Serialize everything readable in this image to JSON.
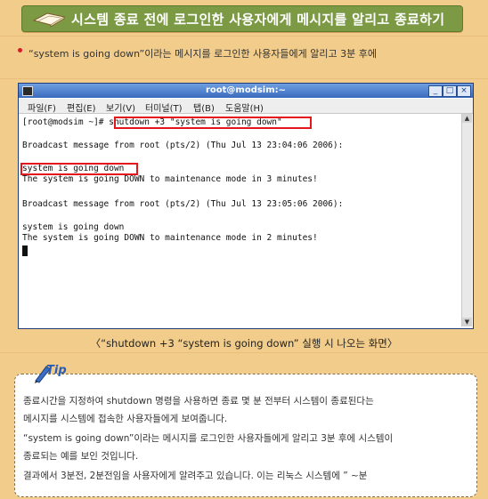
{
  "header": {
    "title": "시스템 종료 전에 로그인한 사용자에게 메시지를 알리고 종료하기",
    "icon": "book-icon"
  },
  "bullet": "“system is going down”이라는 메시지를 로그인한 사용자들에게 알리고 3분 후에",
  "window": {
    "title": "root@modsim:~",
    "menu": [
      "파일(F)",
      "편집(E)",
      "보기(V)",
      "터미널(T)",
      "탭(B)",
      "도움말(H)"
    ],
    "lines": [
      "[root@modsim ~]# shutdown +3 \"system is going down\"",
      "",
      "Broadcast message from root (pts/2) (Thu Jul 13 23:04:06 2006):",
      "",
      "system is going down",
      "The system is going DOWN to maintenance mode in 3 minutes!",
      "",
      "Broadcast message from root (pts/2) (Thu Jul 13 23:05:06 2006):",
      "",
      "system is going down",
      "The system is going DOWN to maintenance mode in 2 minutes!"
    ]
  },
  "caption": "〈“shutdown +3 “system is going down” 실행 시 나오는 화면〉",
  "tip": {
    "label": "Tip",
    "lines": [
      "종료시간을 지정하여 shutdown 명령을 사용하면 종료 몇 분 전부터 시스템이 종료된다는",
      "메시지를 시스템에 접속한 사용자들에게 보여줍니다.",
      "“system is going down”이라는 메시지를 로그인한 사용자들에게 알리고 3분 후에 시스템이",
      "종료되는 예를 보인 것입니다.",
      "결과에서 3분전, 2분전임을 사용자에게 알려주고 있습니다. 이는 리눅스 시스템에 ” ~분"
    ]
  }
}
